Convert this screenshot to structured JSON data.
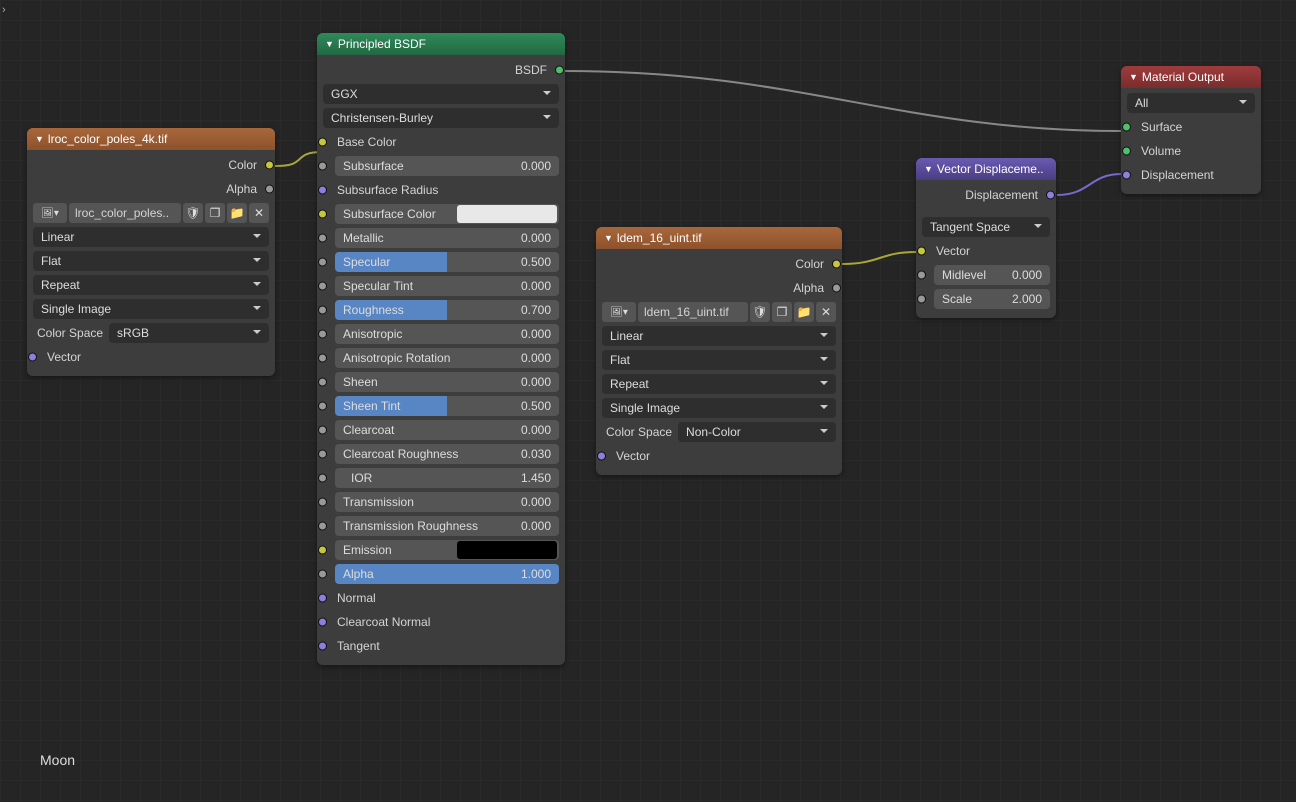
{
  "material_name": "Moon",
  "nodes": {
    "color_tex": {
      "title": "lroc_color_poles_4k.tif",
      "outputs": {
        "color": "Color",
        "alpha": "Alpha"
      },
      "image_name": "lroc_color_poles..",
      "interpolation": "Linear",
      "projection": "Flat",
      "extension": "Repeat",
      "source": "Single Image",
      "color_space_label": "Color Space",
      "color_space": "sRGB",
      "inputs": {
        "vector": "Vector"
      }
    },
    "height_tex": {
      "title": "ldem_16_uint.tif",
      "outputs": {
        "color": "Color",
        "alpha": "Alpha"
      },
      "image_name": "ldem_16_uint.tif",
      "interpolation": "Linear",
      "projection": "Flat",
      "extension": "Repeat",
      "source": "Single Image",
      "color_space_label": "Color Space",
      "color_space": "Non-Color",
      "inputs": {
        "vector": "Vector"
      }
    },
    "bsdf": {
      "title": "Principled BSDF",
      "output": "BSDF",
      "distribution": "GGX",
      "sss_method": "Christensen-Burley",
      "params": {
        "base_color": "Base Color",
        "subsurface": {
          "label": "Subsurface",
          "value": "0.000",
          "fill": 0
        },
        "subsurface_radius": "Subsurface Radius",
        "subsurface_color": "Subsurface Color",
        "metallic": {
          "label": "Metallic",
          "value": "0.000",
          "fill": 0
        },
        "specular": {
          "label": "Specular",
          "value": "0.500",
          "fill": 0.5
        },
        "specular_tint": {
          "label": "Specular Tint",
          "value": "0.000",
          "fill": 0
        },
        "roughness": {
          "label": "Roughness",
          "value": "0.700",
          "fill": 0.5
        },
        "anisotropic": {
          "label": "Anisotropic",
          "value": "0.000",
          "fill": 0
        },
        "aniso_rot": {
          "label": "Anisotropic Rotation",
          "value": "0.000",
          "fill": 0
        },
        "sheen": {
          "label": "Sheen",
          "value": "0.000",
          "fill": 0
        },
        "sheen_tint": {
          "label": "Sheen Tint",
          "value": "0.500",
          "fill": 0.5
        },
        "clearcoat": {
          "label": "Clearcoat",
          "value": "0.000",
          "fill": 0
        },
        "clearcoat_rough": {
          "label": "Clearcoat Roughness",
          "value": "0.030",
          "fill": 0
        },
        "ior": {
          "label": "IOR",
          "value": "1.450"
        },
        "transmission": {
          "label": "Transmission",
          "value": "0.000",
          "fill": 0
        },
        "trans_rough": {
          "label": "Transmission Roughness",
          "value": "0.000",
          "fill": 0
        },
        "emission": "Emission",
        "alpha": {
          "label": "Alpha",
          "value": "1.000",
          "fill": 1
        },
        "normal": "Normal",
        "clearcoat_normal": "Clearcoat Normal",
        "tangent": "Tangent"
      }
    },
    "vdisp": {
      "title": "Vector Displaceme..",
      "output": "Displacement",
      "space": "Tangent Space",
      "inputs": {
        "vector": "Vector",
        "midlevel": {
          "label": "Midlevel",
          "value": "0.000"
        },
        "scale": {
          "label": "Scale",
          "value": "2.000"
        }
      }
    },
    "output": {
      "title": "Material Output",
      "target": "All",
      "inputs": {
        "surface": "Surface",
        "volume": "Volume",
        "displacement": "Displacement"
      }
    }
  }
}
